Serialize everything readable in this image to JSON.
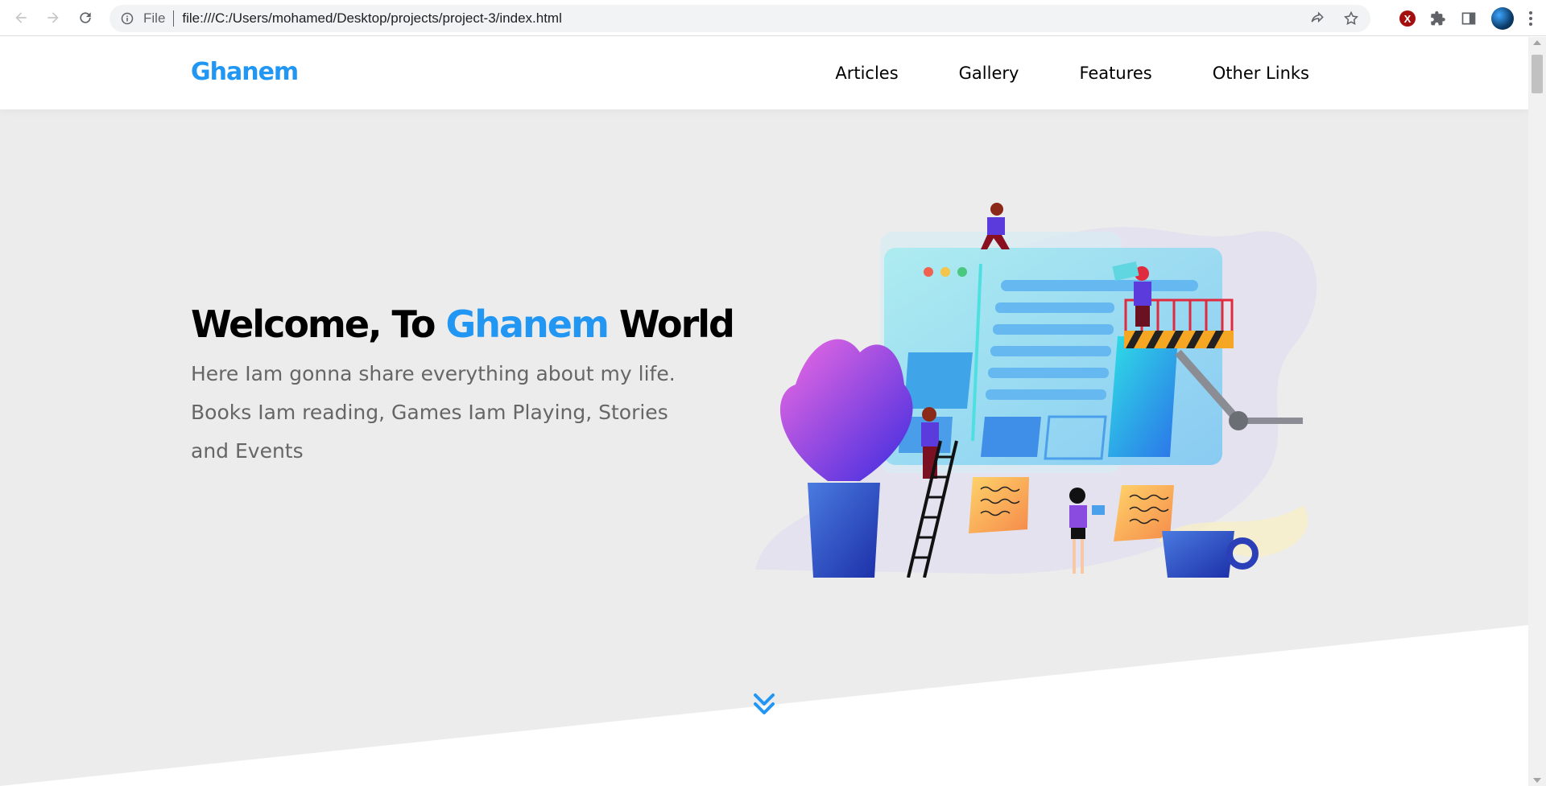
{
  "browser": {
    "scheme_label": "File",
    "url": "file:///C:/Users/mohamed/Desktop/projects/project-3/index.html",
    "extension_label": "X",
    "icons": [
      "back-arrow-icon",
      "forward-arrow-icon",
      "reload-icon",
      "info-icon",
      "share-icon",
      "star-icon",
      "extension-icon",
      "puzzle-icon",
      "side-panel-icon",
      "avatar",
      "menu-dots-icon"
    ]
  },
  "header": {
    "logo": "Ghanem",
    "nav": [
      {
        "label": "Articles"
      },
      {
        "label": "Gallery"
      },
      {
        "label": "Features"
      },
      {
        "label": "Other Links"
      }
    ]
  },
  "landing": {
    "title_before": "Welcome, To ",
    "title_accent": "Ghanem",
    "title_after": " World",
    "description": "Here Iam gonna share everything about my life. Books Iam reading, Games Iam Playing, Stories and Events",
    "go_down_icon": "double-chevron-down-icon"
  },
  "colors": {
    "accent": "#2196f3",
    "landing_bg": "#ececec",
    "text_muted": "#666666"
  }
}
